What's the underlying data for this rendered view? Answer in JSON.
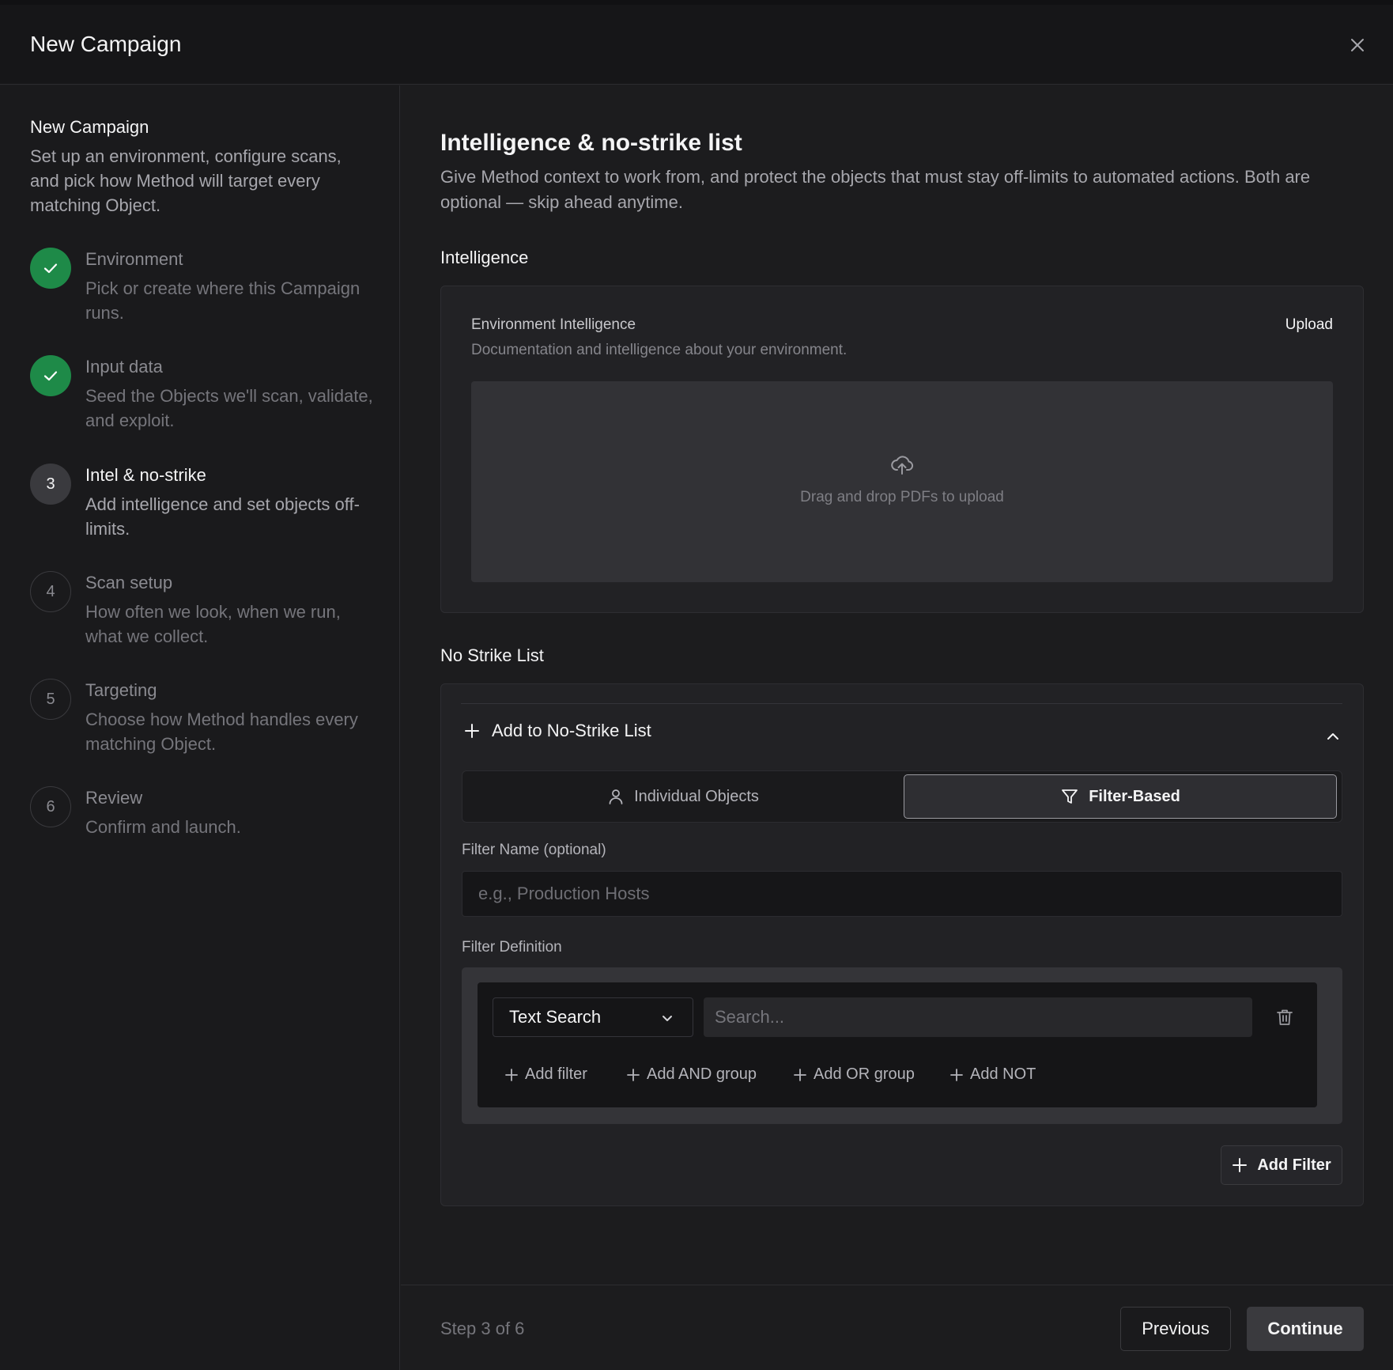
{
  "window": {
    "title": "New Campaign"
  },
  "sidebar": {
    "title": "New Campaign",
    "description": "Set up an environment, configure scans, and pick how Method will target every matching Object.",
    "steps": [
      {
        "number": "1",
        "status": "done",
        "title": "Environment",
        "desc": "Pick or create where this Campaign runs."
      },
      {
        "number": "2",
        "status": "done",
        "title": "Input data",
        "desc": "Seed the Objects we'll scan, validate, and exploit."
      },
      {
        "number": "3",
        "status": "active",
        "title": "Intel & no-strike",
        "desc": "Add intelligence and set objects off-limits."
      },
      {
        "number": "4",
        "status": "todo",
        "title": "Scan setup",
        "desc": "How often we look, when we run, what we collect."
      },
      {
        "number": "5",
        "status": "todo",
        "title": "Targeting",
        "desc": "Choose how Method handles every matching Object."
      },
      {
        "number": "6",
        "status": "todo",
        "title": "Review",
        "desc": "Confirm and launch."
      }
    ]
  },
  "main": {
    "heading": "Intelligence & no-strike list",
    "lead": "Give Method context to work from, and protect the objects that must stay off-limits to automated actions. Both are optional — skip ahead anytime.",
    "intelligence": {
      "section_label": "Intelligence",
      "card_title": "Environment Intelligence",
      "card_desc": "Documentation and intelligence about your environment.",
      "upload_label": "Upload",
      "dropzone_text": "Drag and drop PDFs to upload"
    },
    "no_strike": {
      "section_label": "No Strike List",
      "add_label": "Add to No-Strike List",
      "tabs": {
        "individual": "Individual Objects",
        "filter": "Filter-Based",
        "selected": "filter"
      },
      "filter_name_label": "Filter Name (optional)",
      "filter_name_placeholder": "e.g., Production Hosts",
      "filter_definition_label": "Filter Definition",
      "filter_type": "Text Search",
      "search_placeholder": "Search...",
      "actions": {
        "add_filter": "Add filter",
        "add_and": "Add AND group",
        "add_or": "Add OR group",
        "add_not": "Add NOT"
      },
      "add_filter_button": "Add Filter"
    }
  },
  "footer": {
    "step_info": "Step 3 of 6",
    "previous": "Previous",
    "continue": "Continue"
  },
  "colors": {
    "success": "#1e8a48",
    "background": "#1c1c1e",
    "panel": "#222225"
  },
  "icons": [
    "close-icon",
    "check-icon",
    "upload-cloud-icon",
    "plus-icon",
    "chevron-up-icon",
    "user-icon",
    "filter-icon",
    "chevron-down-icon",
    "trash-icon"
  ]
}
